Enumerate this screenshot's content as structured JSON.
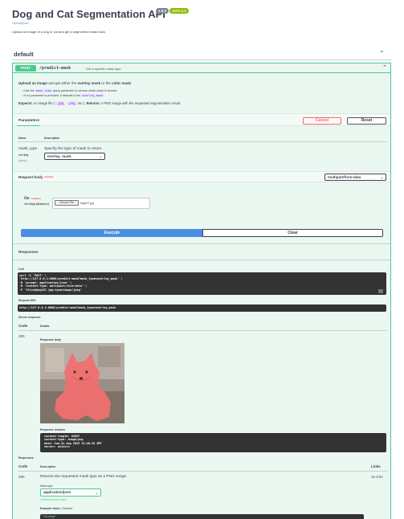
{
  "header": {
    "title": "Dog and Cat Segmentation API",
    "version_badge": "1.0.0",
    "oas_badge": "OAS 3.1",
    "openapi_link": "/openapi.json",
    "description": "Upload an image of a dog or cat and get a segmented mask back."
  },
  "section": {
    "name": "default"
  },
  "operation": {
    "method": "POST",
    "path": "/predict-mask",
    "summary": "Get a specific mask type",
    "desc_line1_pre": "Upload an image",
    "desc_line1_mid": " and get either the ",
    "desc_line1_b1": "overlay mask",
    "desc_line1_or": " or the ",
    "desc_line1_b2": "color mask",
    "desc_line1_end": ".",
    "bullet1_pre": "Use the ",
    "bullet1_code": "mask_type",
    "bullet1_post": " query parameter to choose which mask to receive.",
    "bullet2_pre": "If no parameter is provided, it defaults to the ",
    "bullet2_code": "overlay_mask",
    "expects_label": "Expects:",
    "expects_text": " An image file (",
    "expects_jpg": ".jpg",
    "expects_comma": ", ",
    "expects_png": ".png",
    "expects_etc": ", etc.). ",
    "returns_label": "Returns:",
    "returns_text": " A PNG image with the requested segmentation result."
  },
  "parameters": {
    "tab": "Parameters",
    "cancel": "Cancel",
    "reset": "Reset",
    "col_name": "Name",
    "col_desc": "Description",
    "param_name": "mask_type",
    "param_type": "string",
    "param_in": "(query)",
    "param_desc": "Specify the type of mask to return.",
    "param_value": "overlay_mask"
  },
  "request_body": {
    "label": "Request body",
    "required": "required",
    "content_type": "multipart/form-data",
    "file_label": "file",
    "file_required": "* required",
    "file_type": "string($binary)",
    "choose_file": "Choose File",
    "file_name": "dog107.jpg"
  },
  "actions": {
    "execute": "Execute",
    "clear": "Clear"
  },
  "responses": {
    "title": "Responses",
    "curl_label": "Curl",
    "curl_lines": [
      "curl -X 'POST' \\",
      "  'http://127.0.0.1:8000/predict-mask?mask_type=overlay_mask' \\",
      "  -H 'accept: application/json' \\",
      "  -H 'Content-Type: multipart/form-data' \\",
      "  -F 'file=@dog107.jpg;type=image/jpeg'"
    ],
    "request_url_label": "Request URL",
    "request_url": "http://127.0.0.1:8000/predict-mask?mask_type=overlay_mask",
    "server_response_label": "Server response",
    "col_code": "Code",
    "col_details": "Details",
    "code": "200",
    "body_label": "Response body",
    "headers_label": "Response headers",
    "header_lines": [
      "content-length: 62897",
      "content-type: image/png",
      "date: Sun,31 Aug 2025 11:46:18 GMT",
      "server: uvicorn"
    ]
  },
  "documented": {
    "title": "Responses",
    "col_code": "Code",
    "col_desc": "Description",
    "col_links": "Links",
    "code": "200",
    "desc": "Returns the requested mask type as a PNG image",
    "links": "No links",
    "media_type_label": "Media type",
    "media_type": "application/json",
    "controls_accept": "Controls Accept header.",
    "example_value": "Example Value",
    "schema": "Schema",
    "example_code": "\"string\""
  },
  "colors": {
    "post": "#49cc90",
    "execute": "#4990e2",
    "cancel": "#ff6060",
    "version_badge": "#7d8492",
    "oas_badge": "#89bf04"
  }
}
